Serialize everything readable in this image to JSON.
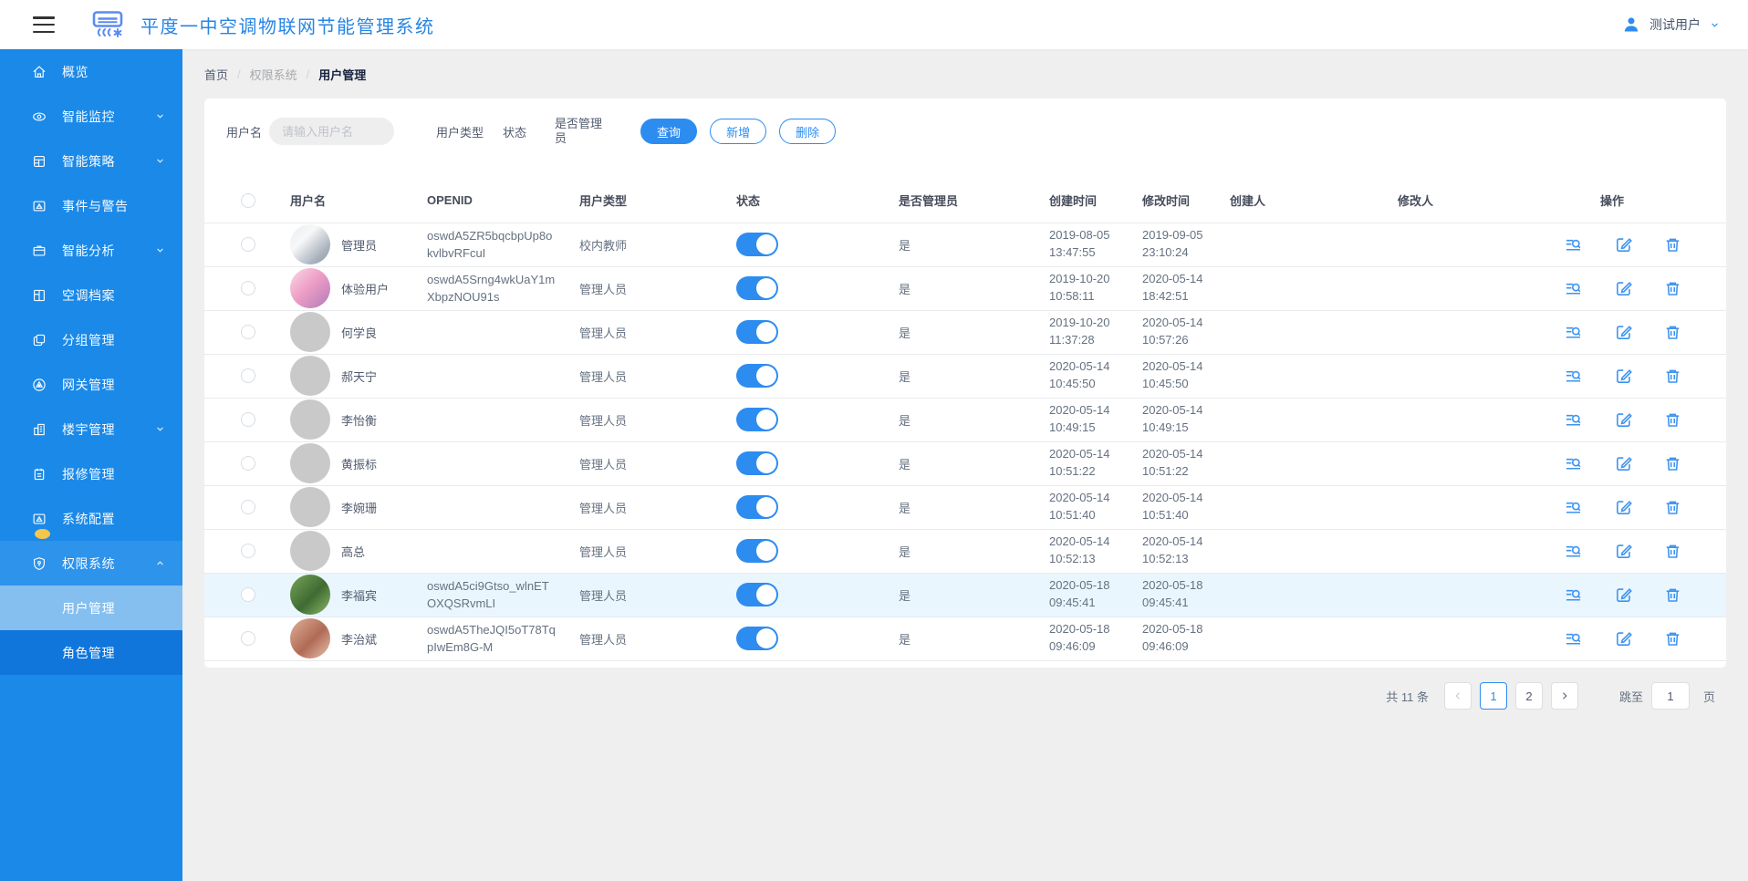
{
  "colors": {
    "primary": "#2d8cf0",
    "sidebar": "#1b89e8",
    "submenu_active": "#85bfef",
    "submenu": "#1176dc",
    "title_blue": "#2785e4",
    "badge_yellow": "#f6c64b",
    "row_highlight": "#eaf6fe"
  },
  "header": {
    "title": "平度一中空调物联网节能管理系统",
    "logo_icon": "air-conditioner-icon",
    "menu_icon": "hamburger-icon",
    "user": {
      "icon": "user-icon",
      "name": "测试用户",
      "chevron": "chevron-down-icon"
    }
  },
  "sidebar": {
    "items": [
      {
        "id": "overview",
        "label": "概览",
        "icon": "home-icon"
      },
      {
        "id": "monitor",
        "label": "智能监控",
        "icon": "eye-icon",
        "expandable": true
      },
      {
        "id": "strategy",
        "label": "智能策略",
        "icon": "strategy-icon",
        "expandable": true
      },
      {
        "id": "events",
        "label": "事件与警告",
        "icon": "event-icon"
      },
      {
        "id": "analysis",
        "label": "智能分析",
        "icon": "analysis-icon",
        "expandable": true
      },
      {
        "id": "archive",
        "label": "空调档案",
        "icon": "archive-icon"
      },
      {
        "id": "group",
        "label": "分组管理",
        "icon": "group-icon"
      },
      {
        "id": "gateway",
        "label": "网关管理",
        "icon": "gateway-icon"
      },
      {
        "id": "building",
        "label": "楼宇管理",
        "icon": "building-icon",
        "expandable": true
      },
      {
        "id": "repair",
        "label": "报修管理",
        "icon": "repair-icon"
      },
      {
        "id": "config",
        "label": "系统配置",
        "icon": "config-icon",
        "badge": true
      },
      {
        "id": "permission",
        "label": "权限系统",
        "icon": "shield-icon",
        "expandable": true,
        "expanded": true,
        "active_parent": true
      }
    ],
    "submenu": [
      {
        "id": "user-management",
        "label": "用户管理",
        "active": true
      },
      {
        "id": "role-management",
        "label": "角色管理"
      }
    ]
  },
  "breadcrumb": {
    "items": [
      "首页",
      "权限系统",
      "用户管理"
    ],
    "separator": "/"
  },
  "filters": {
    "username_label": "用户名",
    "username_placeholder": "请输入用户名",
    "username_value": "",
    "usertype_label": "用户类型",
    "status_label": "状态",
    "admin_label": "是否管理员",
    "buttons": {
      "query": "查询",
      "add": "新增",
      "delete": "删除"
    }
  },
  "table": {
    "columns": [
      "用户名",
      "OPENID",
      "用户类型",
      "状态",
      "是否管理员",
      "创建时间",
      "修改时间",
      "创建人",
      "修改人",
      "操作"
    ],
    "row_action_icons": [
      "detail-icon",
      "edit-icon",
      "delete-icon"
    ],
    "rows": [
      {
        "name": "管理员",
        "avatar": "photo-doctor",
        "openid": "oswdA5ZR5bqcbpUp8okvlbvRFcuI",
        "type": "校内教师",
        "status": true,
        "admin": "是",
        "created": "2019-08-05 13:47:55",
        "modified": "2019-09-05 23:10:24",
        "creator": "",
        "modifier": ""
      },
      {
        "name": "体验用户",
        "avatar": "photo-pink",
        "openid": "oswdA5Srng4wkUaY1mXbpzNOU91s",
        "type": "管理人员",
        "status": true,
        "admin": "是",
        "created": "2019-10-20 10:58:11",
        "modified": "2020-05-14 18:42:51",
        "creator": "",
        "modifier": ""
      },
      {
        "name": "何学良",
        "avatar": "gray",
        "openid": "",
        "type": "管理人员",
        "status": true,
        "admin": "是",
        "created": "2019-10-20 11:37:28",
        "modified": "2020-05-14 10:57:26",
        "creator": "",
        "modifier": ""
      },
      {
        "name": "郝天宁",
        "avatar": "gray",
        "openid": "",
        "type": "管理人员",
        "status": true,
        "admin": "是",
        "created": "2020-05-14 10:45:50",
        "modified": "2020-05-14 10:45:50",
        "creator": "",
        "modifier": ""
      },
      {
        "name": "李怡衡",
        "avatar": "gray",
        "openid": "",
        "type": "管理人员",
        "status": true,
        "admin": "是",
        "created": "2020-05-14 10:49:15",
        "modified": "2020-05-14 10:49:15",
        "creator": "",
        "modifier": ""
      },
      {
        "name": "黄振标",
        "avatar": "gray",
        "openid": "",
        "type": "管理人员",
        "status": true,
        "admin": "是",
        "created": "2020-05-14 10:51:22",
        "modified": "2020-05-14 10:51:22",
        "creator": "",
        "modifier": ""
      },
      {
        "name": "李婉珊",
        "avatar": "gray",
        "openid": "",
        "type": "管理人员",
        "status": true,
        "admin": "是",
        "created": "2020-05-14 10:51:40",
        "modified": "2020-05-14 10:51:40",
        "creator": "",
        "modifier": ""
      },
      {
        "name": "高总",
        "avatar": "gray",
        "openid": "",
        "type": "管理人员",
        "status": true,
        "admin": "是",
        "created": "2020-05-14 10:52:13",
        "modified": "2020-05-14 10:52:13",
        "creator": "",
        "modifier": ""
      },
      {
        "name": "李福宾",
        "avatar": "photo-green",
        "openid": "oswdA5ci9Gtso_wlnETOXQSRvmLI",
        "type": "管理人员",
        "status": true,
        "admin": "是",
        "created": "2020-05-18 09:45:41",
        "modified": "2020-05-18 09:45:41",
        "creator": "",
        "modifier": "",
        "highlight": true
      },
      {
        "name": "李治斌",
        "avatar": "photo-warm",
        "openid": "oswdA5TheJQI5oT78TqpIwEm8G-M",
        "type": "管理人员",
        "status": true,
        "admin": "是",
        "created": "2020-05-18 09:46:09",
        "modified": "2020-05-18 09:46:09",
        "creator": "",
        "modifier": ""
      }
    ]
  },
  "pagination": {
    "total_label": "共 11 条",
    "pages": [
      "1",
      "2"
    ],
    "current": "1",
    "prev_icon": "chevron-left-icon",
    "next_icon": "chevron-right-icon",
    "jump_label": "跳至",
    "jump_value": "1",
    "unit_label": "页"
  }
}
